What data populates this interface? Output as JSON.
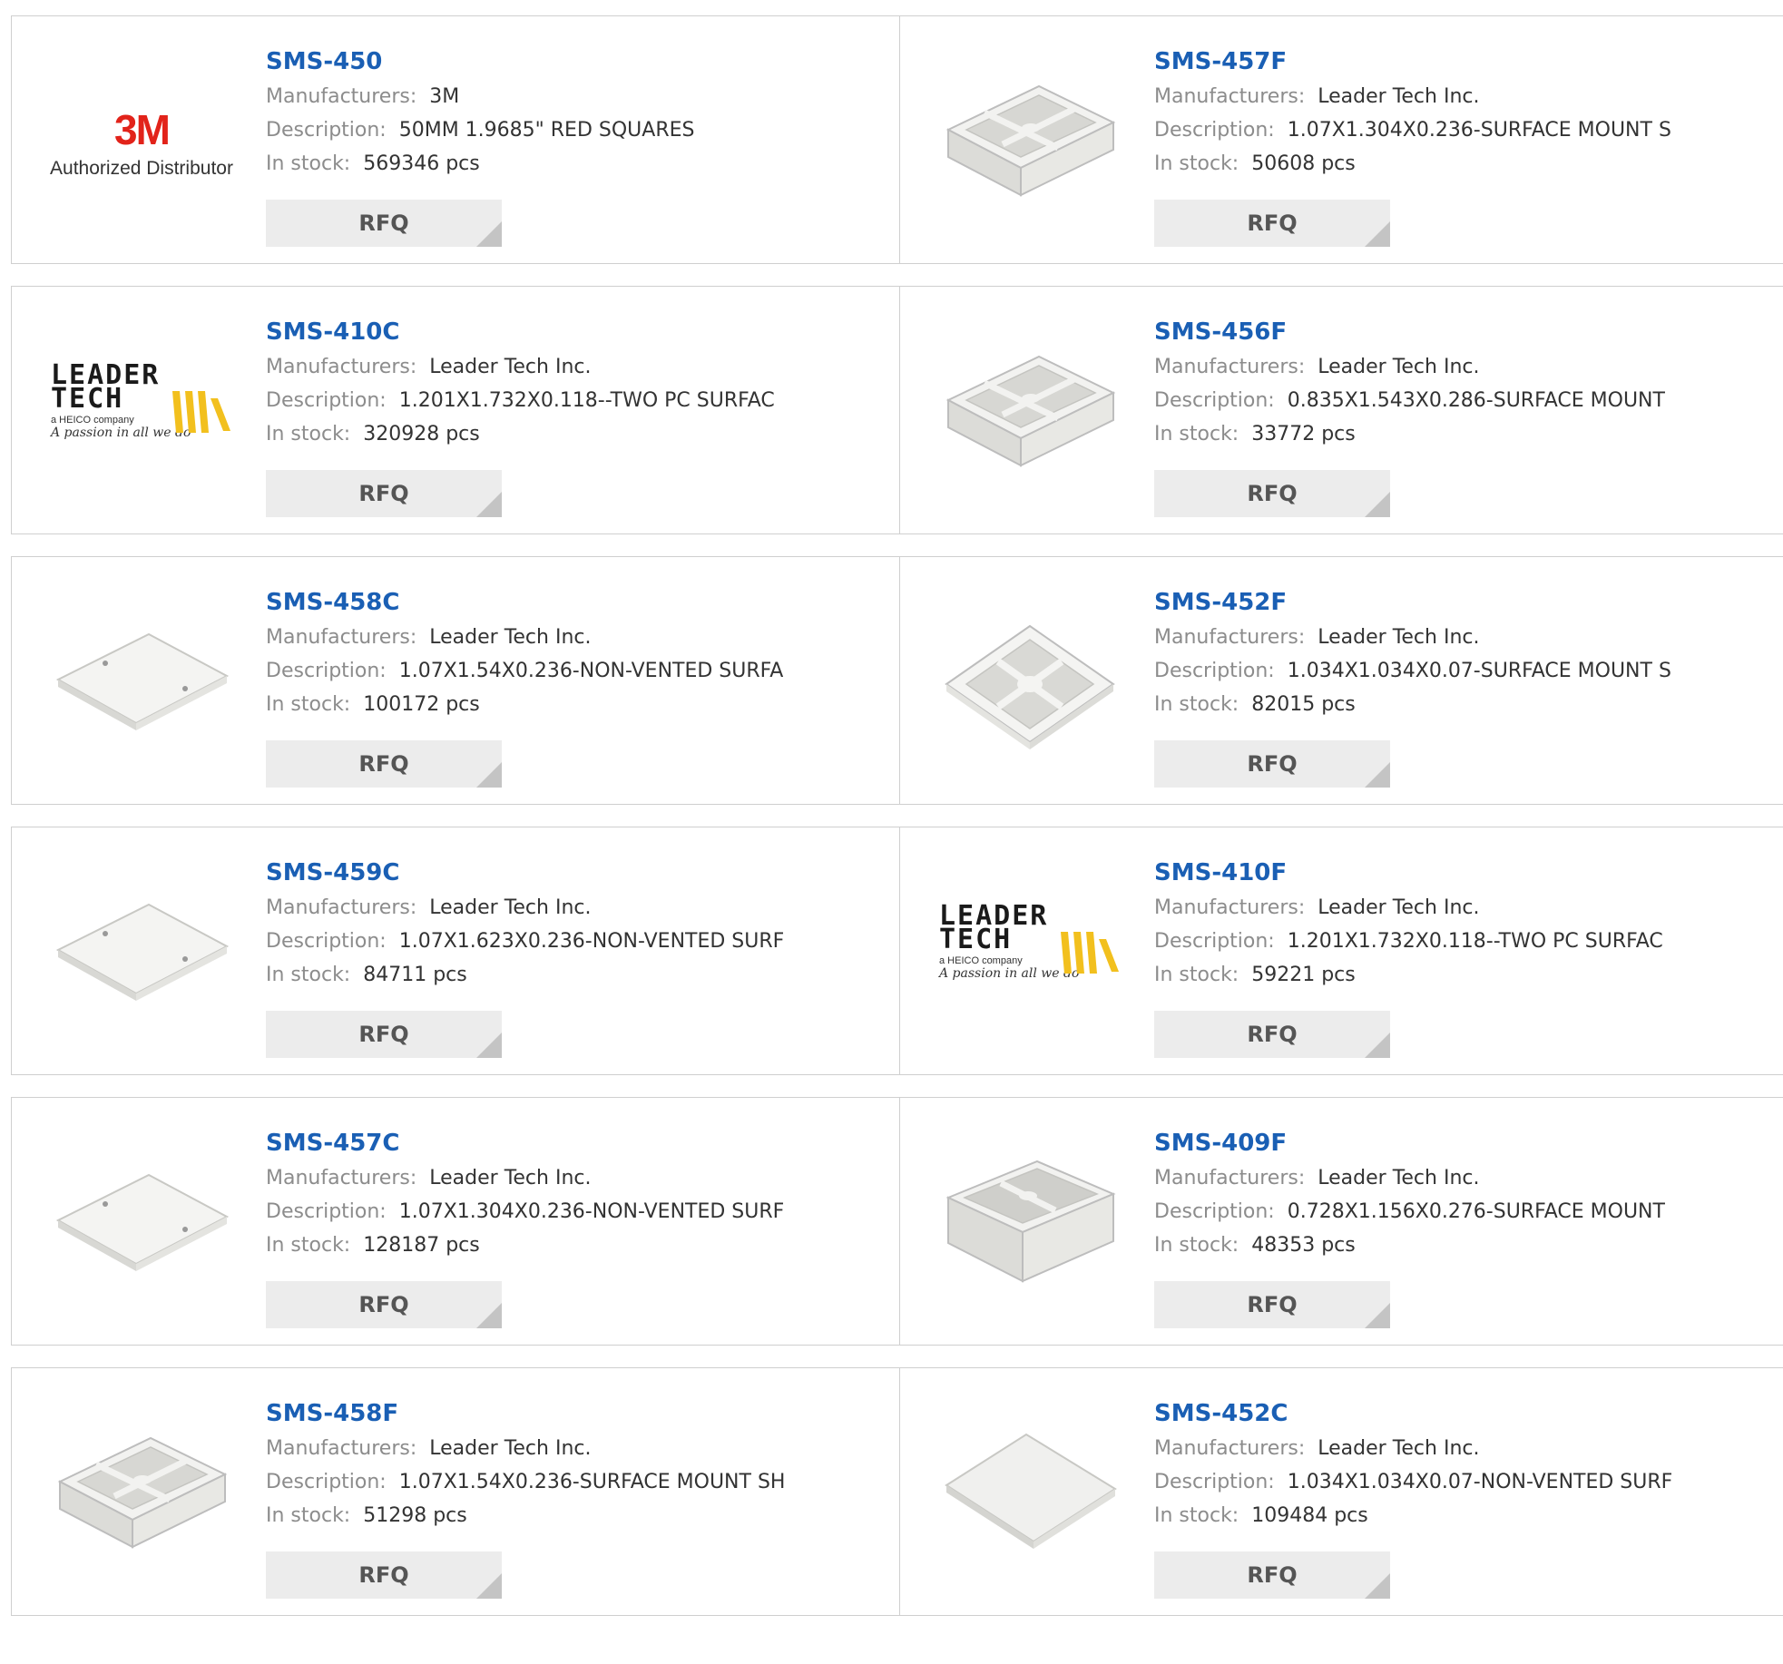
{
  "labels": {
    "manufacturers": "Manufacturers:",
    "description": "Description:",
    "in_stock": "In stock:",
    "rfq": "RFQ"
  },
  "logos": {
    "three_m": {
      "mark": "3M",
      "subtitle": "Authorized Distributor"
    },
    "leader_tech": {
      "line1": "LEADER",
      "line2": "TECH",
      "heico": "a HEICO company",
      "tagline": "A passion in all we do"
    }
  },
  "products": [
    {
      "pn": "SMS-450",
      "manufacturer": "3M",
      "description": "50MM 1.9685\" RED SQUARES",
      "stock": "569346 pcs",
      "image": "logo-3m"
    },
    {
      "pn": "SMS-457F",
      "manufacturer": "Leader Tech Inc.",
      "description": "1.07X1.304X0.236-SURFACE MOUNT S",
      "stock": "50608 pcs",
      "image": "frame-quad"
    },
    {
      "pn": "SMS-410C",
      "manufacturer": "Leader Tech Inc.",
      "description": "1.201X1.732X0.118--TWO PC SURFAC",
      "stock": "320928 pcs",
      "image": "logo-leadertech"
    },
    {
      "pn": "SMS-456F",
      "manufacturer": "Leader Tech Inc.",
      "description": "0.835X1.543X0.286-SURFACE MOUNT",
      "stock": "33772 pcs",
      "image": "frame-quad"
    },
    {
      "pn": "SMS-458C",
      "manufacturer": "Leader Tech Inc.",
      "description": "1.07X1.54X0.236-NON-VENTED SURFA",
      "stock": "100172 pcs",
      "image": "cover-plate"
    },
    {
      "pn": "SMS-452F",
      "manufacturer": "Leader Tech Inc.",
      "description": "1.034X1.034X0.07-SURFACE MOUNT S",
      "stock": "82015 pcs",
      "image": "frame-square"
    },
    {
      "pn": "SMS-459C",
      "manufacturer": "Leader Tech Inc.",
      "description": "1.07X1.623X0.236-NON-VENTED SURF",
      "stock": "84711 pcs",
      "image": "cover-plate"
    },
    {
      "pn": "SMS-410F",
      "manufacturer": "Leader Tech Inc.",
      "description": "1.201X1.732X0.118--TWO PC SURFAC",
      "stock": "59221 pcs",
      "image": "logo-leadertech"
    },
    {
      "pn": "SMS-457C",
      "manufacturer": "Leader Tech Inc.",
      "description": "1.07X1.304X0.236-NON-VENTED SURF",
      "stock": "128187 pcs",
      "image": "cover-plate"
    },
    {
      "pn": "SMS-409F",
      "manufacturer": "Leader Tech Inc.",
      "description": "0.728X1.156X0.276-SURFACE MOUNT",
      "stock": "48353 pcs",
      "image": "frame-deep"
    },
    {
      "pn": "SMS-458F",
      "manufacturer": "Leader Tech Inc.",
      "description": "1.07X1.54X0.236-SURFACE MOUNT SH",
      "stock": "51298 pcs",
      "image": "frame-quad"
    },
    {
      "pn": "SMS-452C",
      "manufacturer": "Leader Tech Inc.",
      "description": "1.034X1.034X0.07-NON-VENTED SURF",
      "stock": "109484 pcs",
      "image": "cover-square"
    }
  ],
  "colors": {
    "link": "#1a5fb4",
    "label": "#8c8c8c",
    "value": "#333333",
    "button_bg": "#ececec",
    "border": "#cfcfcf",
    "brand_3m": "#e2231a",
    "leadertech_yellow": "#f2c01e"
  }
}
